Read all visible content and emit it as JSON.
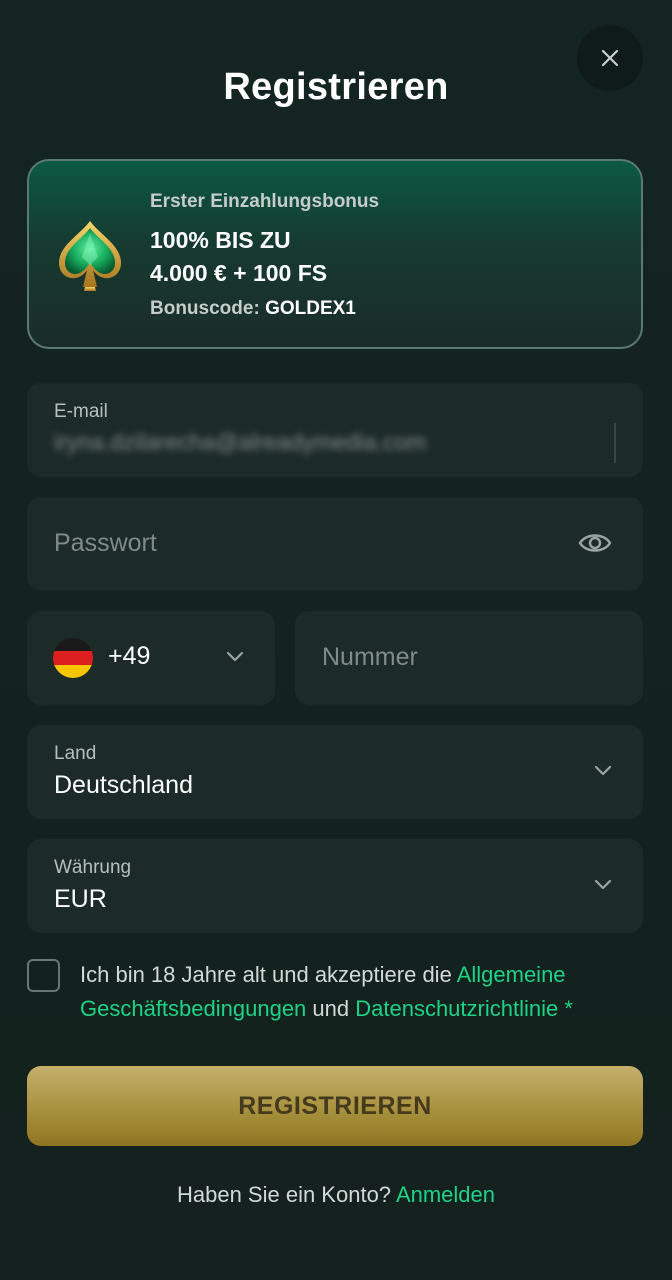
{
  "dialog": {
    "title": "Registrieren",
    "close_icon": "close-icon"
  },
  "bonus": {
    "icon": "spade-gem-icon",
    "subtitle": "Erster Einzahlungsbonus",
    "line1": "100% BIS ZU",
    "line2": "4.000 € + 100 FS",
    "code_label": "Bonuscode:",
    "code_value": "GOLDEX1"
  },
  "email": {
    "label": "E-mail",
    "value": "iryna.dzilarecha@alreadymedia.com"
  },
  "password": {
    "placeholder": "Passwort",
    "toggle_icon": "eye-icon"
  },
  "phone": {
    "country_flag": "germany-flag-icon",
    "dial_code": "+49",
    "number_placeholder": "Nummer"
  },
  "country": {
    "label": "Land",
    "value": "Deutschland"
  },
  "currency": {
    "label": "Währung",
    "value": "EUR"
  },
  "terms": {
    "text_before": "Ich bin 18 Jahre alt und akzeptiere die ",
    "link_terms": "Allgemeine Geschäftsbedingungen",
    "text_middle": " und ",
    "link_privacy": "Datenschutzrichtlinie",
    "required_mark": " *",
    "checked": false
  },
  "submit": {
    "label": "REGISTRIEREN"
  },
  "footer": {
    "question": "Haben Sie ein Konto? ",
    "login_link": "Anmelden"
  },
  "colors": {
    "background": "#14201d",
    "field": "#1d2b28",
    "accent_link": "#1ed286",
    "button_gold": "#a8913d"
  }
}
